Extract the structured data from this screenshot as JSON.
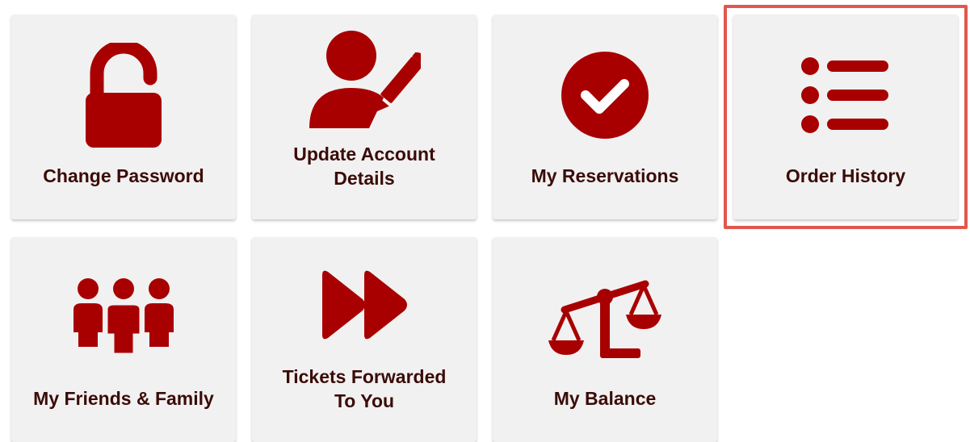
{
  "theme": {
    "icon_color": "#a80000",
    "label_color": "#3a0c08",
    "tile_background": "#f2f1f1",
    "highlight_color": "#e2574c"
  },
  "tiles": [
    {
      "label": "Change Password",
      "icon": "unlocked-padlock-icon"
    },
    {
      "label": "Update Account\nDetails",
      "icon": "user-edit-icon"
    },
    {
      "label": "My Reservations",
      "icon": "check-circle-icon"
    },
    {
      "label": "Order History",
      "icon": "list-icon",
      "highlighted": true
    },
    {
      "label": "My Friends & Family",
      "icon": "group-icon"
    },
    {
      "label": "Tickets Forwarded\nTo You",
      "icon": "forward-icon"
    },
    {
      "label": "My Balance",
      "icon": "balance-scale-icon"
    }
  ]
}
